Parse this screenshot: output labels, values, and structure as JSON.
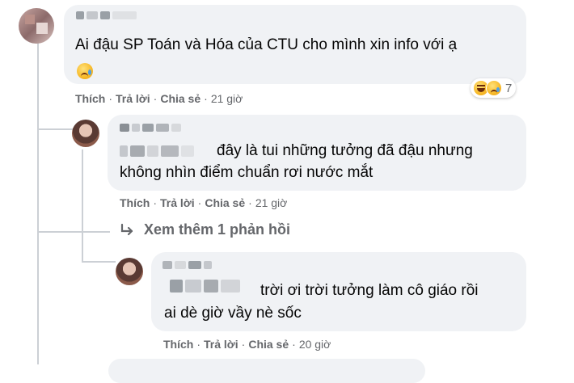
{
  "comments": [
    {
      "text_lines": [
        "Ai đậu SP Toán và Hóa của CTU cho mình xin info với ạ"
      ],
      "emoji_icon": "sad-cry-icon",
      "actions": {
        "like": "Thích",
        "reply": "Trả lời",
        "share": "Chia sẻ",
        "time": "21 giờ"
      },
      "reactions": {
        "icons": [
          "haha-icon",
          "sad-icon"
        ],
        "count": "7"
      }
    },
    {
      "text_lines": [
        "đây là tui những tưởng đã đậu nhưng",
        "không nhìn điểm chuẩn rơi nước mắt"
      ],
      "actions": {
        "like": "Thích",
        "reply": "Trả lời",
        "share": "Chia sẻ",
        "time": "21 giờ"
      }
    },
    {
      "text_lines": [
        "trời ơi trời tưởng làm cô giáo rồi",
        "ai dè giờ vầy nè sốc"
      ],
      "actions": {
        "like": "Thích",
        "reply": "Trả lời",
        "share": "Chia sẻ",
        "time": "20 giờ"
      }
    }
  ],
  "more_replies": {
    "label": "Xem thêm 1 phản hồi",
    "icon": "reply-arrow-icon"
  },
  "separator": "·",
  "colors": {
    "bubble": "#f0f2f5",
    "meta": "#65676b",
    "text": "#050505",
    "thread_line": "#ccd0d5"
  }
}
